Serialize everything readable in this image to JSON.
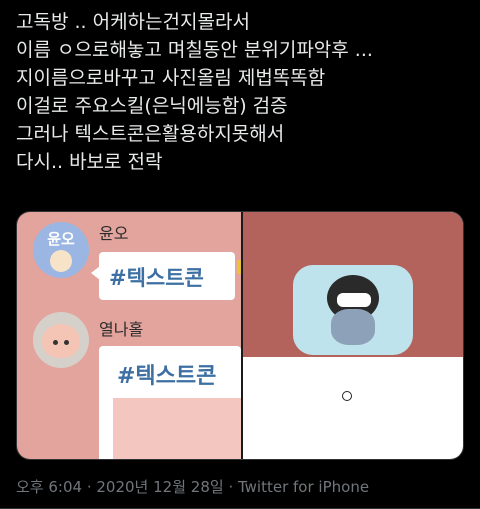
{
  "tweet": {
    "lines": [
      "고독방 .. 어케하는건지몰라서",
      "이름 ㅇ으로해놓고 며칠동안 분위기파악후 ...",
      "지이름으로바꾸고 사진올림 제법똑똑함",
      "이걸로 주요스킬(은닉에능함) 검증",
      "그러나 텍스트콘은활용하지못해서",
      "다시.. 바보로 전락"
    ]
  },
  "media": {
    "left": {
      "avatar1_label": "윤오",
      "name1": "윤오",
      "bubble1_text": "#텍스트콘",
      "name2": "열나홀",
      "bubble2_text": "#텍스트콘"
    },
    "right": {
      "caption": "ㅇ"
    }
  },
  "meta": {
    "time": "오후 6:04",
    "separator1": " · ",
    "date": "2020년 12월 28일",
    "separator2": " · ",
    "source": "Twitter for iPhone"
  },
  "colors": {
    "background": "#000000",
    "text": "#e7e9ea",
    "meta": "#71767b",
    "chat_bg_left": "#e2a49c",
    "chat_bg_right_top": "#b4635c",
    "hashtag": "#3d6fa3"
  }
}
